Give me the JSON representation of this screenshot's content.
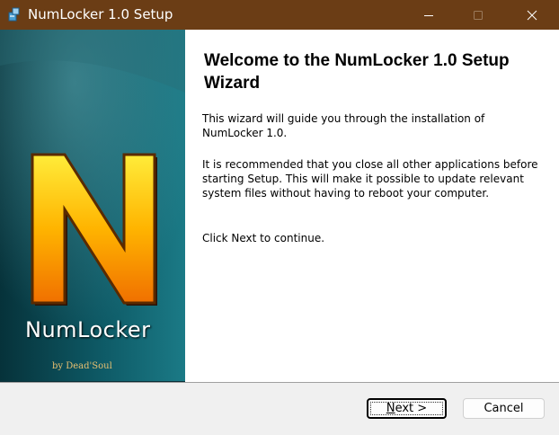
{
  "window": {
    "title": "NumLocker 1.0 Setup",
    "icon": "installer-icon",
    "controls": [
      "minimize-icon",
      "maximize-icon",
      "close-icon"
    ],
    "titlebar_color": "#6b3d15"
  },
  "banner": {
    "logo_letter": "N",
    "product_name": "NumLocker",
    "author": "by Dead'Soul"
  },
  "content": {
    "title": "Welcome to the NumLocker 1.0 Setup Wizard",
    "paragraphs": [
      "This wizard will guide you through the installation of NumLocker 1.0.",
      "It is recommended that you close all other applications before starting Setup. This will make it possible to update relevant system files without having to reboot your computer.",
      "Click Next to continue."
    ]
  },
  "buttons": {
    "next_label_mnemonic": "N",
    "next_label_rest": "ext >",
    "cancel_label": "Cancel"
  }
}
